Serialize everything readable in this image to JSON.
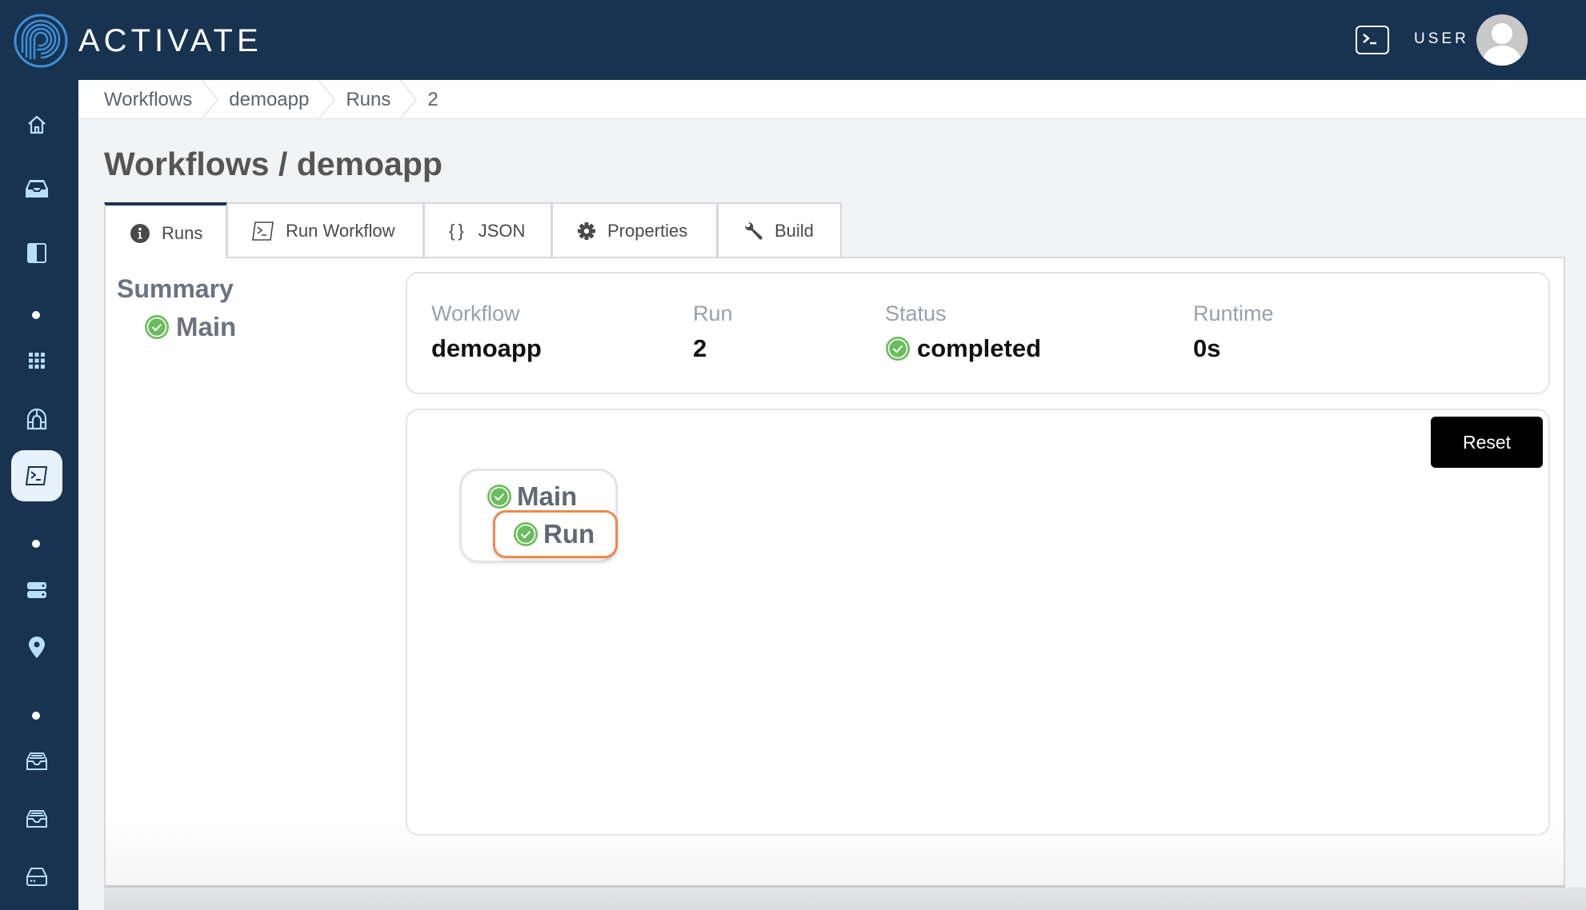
{
  "app": {
    "brand": "ACTIVATE",
    "brand_color": "#3d8fd8",
    "header_bg": "#183350",
    "user_label": "USER"
  },
  "header": {
    "terminal_icon": "terminal-icon",
    "avatar_icon": "user-avatar-icon"
  },
  "sidebar": {
    "items": [
      {
        "icon": "home-icon"
      },
      {
        "icon": "inbox-icon"
      },
      {
        "icon": "sidebar-panel-icon"
      },
      {
        "icon": "dot-separator"
      },
      {
        "icon": "apps-grid-icon"
      },
      {
        "icon": "gateway-icon"
      },
      {
        "icon": "terminal-icon",
        "active": true
      },
      {
        "icon": "dot-separator"
      },
      {
        "icon": "server-icon"
      },
      {
        "icon": "location-pin-icon"
      },
      {
        "icon": "dot-separator"
      },
      {
        "icon": "storage-tray-icon"
      },
      {
        "icon": "storage-tray-icon"
      },
      {
        "icon": "hard-drive-icon"
      }
    ]
  },
  "breadcrumb": [
    "Workflows",
    "demoapp",
    "Runs",
    "2"
  ],
  "page": {
    "title": "Workflows / demoapp"
  },
  "tabs": [
    {
      "label": "Runs",
      "icon": "info-icon",
      "active": true
    },
    {
      "label": "Run Workflow",
      "icon": "terminal-icon"
    },
    {
      "label": "JSON",
      "icon": "braces-icon"
    },
    {
      "label": "Properties",
      "icon": "gear-icon"
    },
    {
      "label": "Build",
      "icon": "wrench-icon"
    }
  ],
  "summary": {
    "title": "Summary",
    "items": [
      {
        "label": "Main",
        "status": "completed"
      }
    ]
  },
  "run_info": {
    "workflow_label": "Workflow",
    "workflow_value": "demoapp",
    "run_label": "Run",
    "run_value": "2",
    "status_label": "Status",
    "status_value": "completed",
    "runtime_label": "Runtime",
    "runtime_value": "0s"
  },
  "graph": {
    "reset_label": "Reset",
    "nodes": [
      {
        "label": "Main",
        "status": "completed"
      },
      {
        "label": "Run",
        "status": "completed",
        "selected": true
      }
    ],
    "selected_color": "#ec8a4e",
    "success_color": "#6dbb5f"
  }
}
